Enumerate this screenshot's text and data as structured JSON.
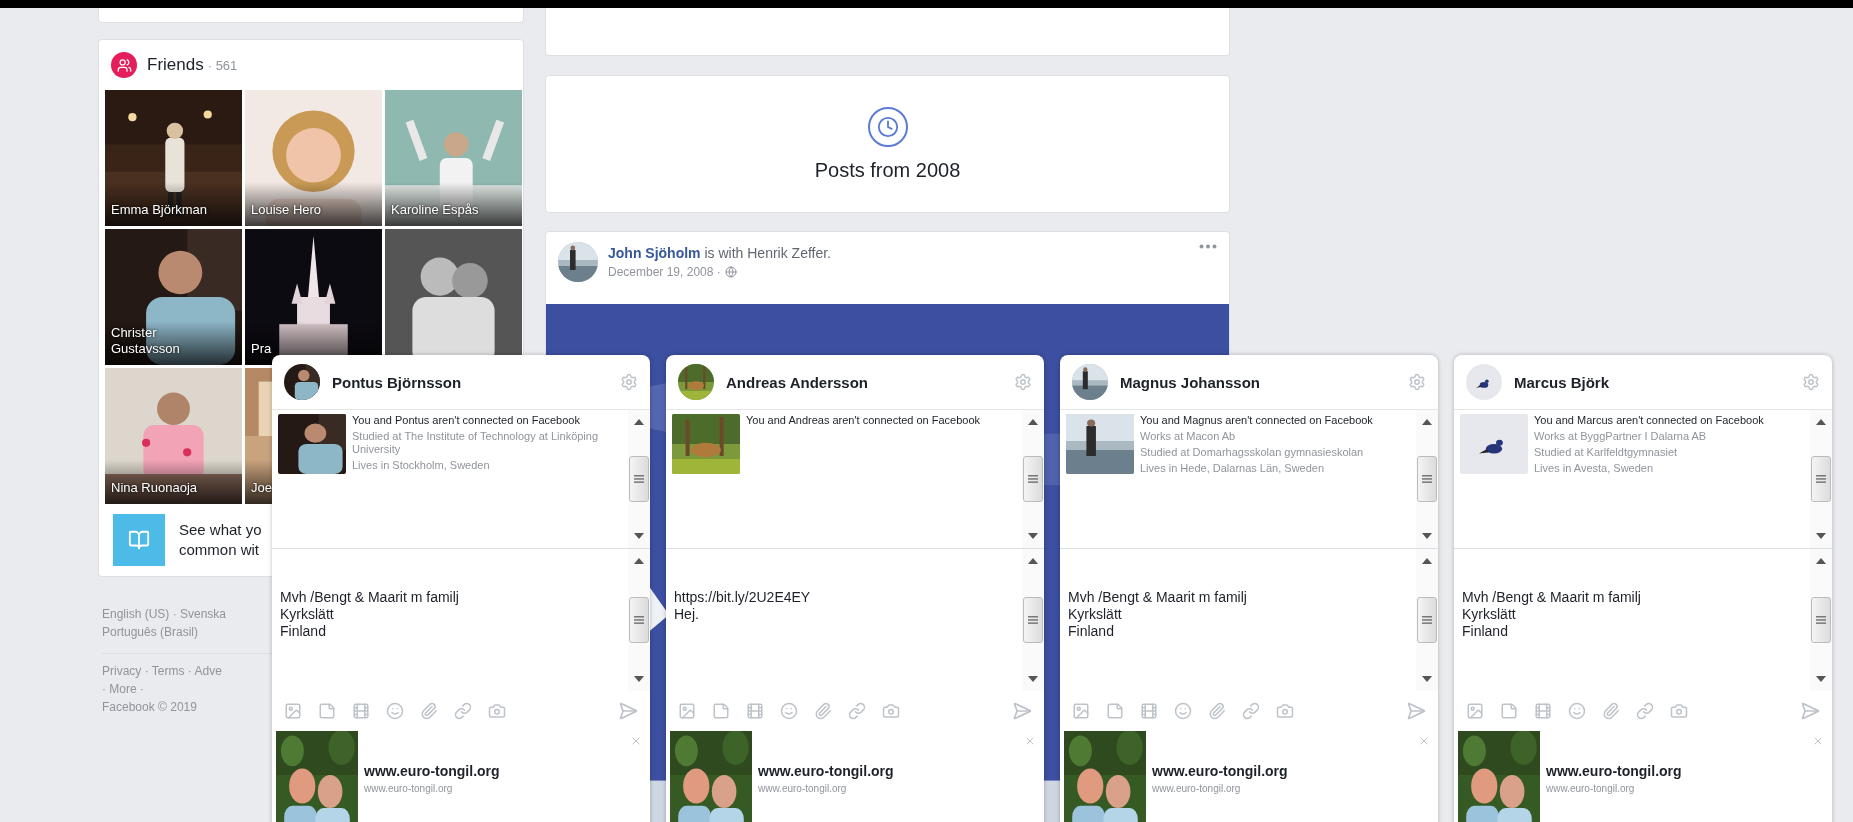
{
  "friends": {
    "title": "Friends",
    "count": "· 561",
    "tiles": [
      {
        "kind": "named",
        "name": "Emma Björkman"
      },
      {
        "kind": "named",
        "name": "Louise Hero"
      },
      {
        "kind": "named",
        "name": "Karoline Espås"
      },
      {
        "kind": "named",
        "name": "Christer Gustavsson"
      },
      {
        "kind": "named",
        "name": "Pra"
      },
      {
        "kind": "picture"
      },
      {
        "kind": "named",
        "name": "Nina Ruonaoja"
      },
      {
        "kind": "named",
        "name": "Joe"
      }
    ]
  },
  "promo": {
    "lines": [
      "See what yo",
      "common wit"
    ]
  },
  "footer": {
    "language_lines": [
      "English (US) · Svenska",
      "Português (Brasil)"
    ],
    "link_lines": [
      "Privacy · Terms · Adve",
      "· More ·"
    ],
    "copyright": "Facebook © 2019"
  },
  "posts_divider": {
    "label": "Posts from 2008"
  },
  "post": {
    "header": "**John Sjöholm** is with Henrik Zeffer.",
    "date": "December 19, 2008 ·"
  },
  "chats": [
    {
      "name": "Pontus Björnsson",
      "intro": "You and Pontus aren't connected on Facebook",
      "details": [
        "Studied at The Institute of Technology at Linköping University",
        "Lives in Stockholm, Sweden"
      ],
      "message_lines": [
        "Mvh /Bengt & Maarit m familj",
        "Kyrkslätt",
        "Finland"
      ],
      "ad": {
        "title": "www.euro-tongil.org",
        "url": "www.euro-tongil.org"
      }
    },
    {
      "name": "Andreas Andersson",
      "intro": "You and Andreas aren't connected on Facebook",
      "message_lines": [
        "https://bit.ly/2U2E4EY",
        "Hej."
      ],
      "ad": {
        "title": "www.euro-tongil.org",
        "url": "www.euro-tongil.org"
      }
    },
    {
      "name": "Magnus Johansson",
      "intro": "You and Magnus aren't connected on Facebook",
      "details": [
        "Works at Macon Ab",
        "Studied at Domarhagsskolan gymnasieskolan",
        "Lives in Hede, Dalarnas Län, Sweden"
      ],
      "message_lines": [
        "Mvh /Bengt & Maarit m familj",
        "Kyrkslätt",
        "Finland"
      ],
      "ad": {
        "title": "www.euro-tongil.org",
        "url": "www.euro-tongil.org"
      }
    },
    {
      "name": "Marcus Björk",
      "intro": "You and Marcus aren't connected on Facebook",
      "details": [
        "Works at ByggPartner I Dalarna AB",
        "Studied at Karlfeldtgymnasiet",
        "Lives in Avesta, Sweden"
      ],
      "message_lines": [
        "Mvh /Bengt & Maarit m familj",
        "Kyrkslätt",
        "Finland"
      ],
      "ad": {
        "title": "www.euro-tongil.org",
        "url": "www.euro-tongil.org"
      }
    }
  ]
}
